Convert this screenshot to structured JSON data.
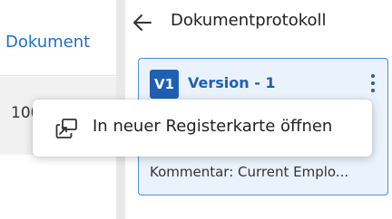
{
  "left": {
    "header_label": "Dokument",
    "row_value": "100"
  },
  "panel": {
    "title": "Dokumentprotokoll",
    "back_icon": "arrow-left-icon"
  },
  "version_card": {
    "badge": "V1",
    "title": "Version - 1",
    "comment": "Kommentar: Current Emplo...",
    "menu_icon": "kebab-vertical-icon"
  },
  "context_menu": {
    "items": [
      {
        "label": "In neuer Registerkarte öffnen",
        "icon": "open-in-new-tab-icon"
      }
    ]
  },
  "colors": {
    "accent": "#1f5fb4",
    "link": "#1f6fc3",
    "card_background": "#eaf2fb",
    "card_border": "#4a8fd8"
  }
}
